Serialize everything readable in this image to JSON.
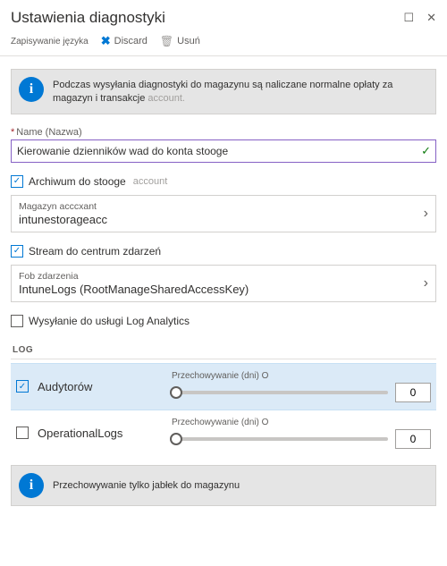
{
  "header": {
    "title": "Ustawienia diagnostyki"
  },
  "toolbar": {
    "pin_hint": "Zapisywanie języka",
    "discard_label": "Discard",
    "delete_label": "Usuń"
  },
  "info": {
    "text_main": "Podczas wysyłania diagnostyki do magazynu są naliczane normalne opłaty za magazyn i transakcje",
    "text_dim": "account."
  },
  "name_field": {
    "label": "Name (Nazwa)",
    "value": "Kierowanie dzienników wad do konta stooge"
  },
  "archive": {
    "label": "Archiwum do stooge",
    "dim": "account",
    "checked": true,
    "selector_label": "Magazyn acccxant",
    "selector_value": "intunestorageacc"
  },
  "stream": {
    "label": "Stream do centrum zdarzeń",
    "checked": true,
    "selector_label": "Fob zdarzenia",
    "selector_value": "IntuneLogs (RootManageSharedAccessKey)"
  },
  "log_analytics": {
    "label": "Wysyłanie do usługi Log Analytics",
    "checked": false
  },
  "log_section": {
    "header": "LOG",
    "retention_label": "Przechowywanie (dni) O",
    "rows": [
      {
        "name": "Audytorów",
        "checked": true,
        "retention": "0",
        "selected": true
      },
      {
        "name": "OperationalLogs",
        "checked": false,
        "retention": "0",
        "selected": false
      }
    ]
  },
  "footer": {
    "text_main": "Przechowywanie tylko jabłek do magazynu",
    "text_dim": ""
  }
}
